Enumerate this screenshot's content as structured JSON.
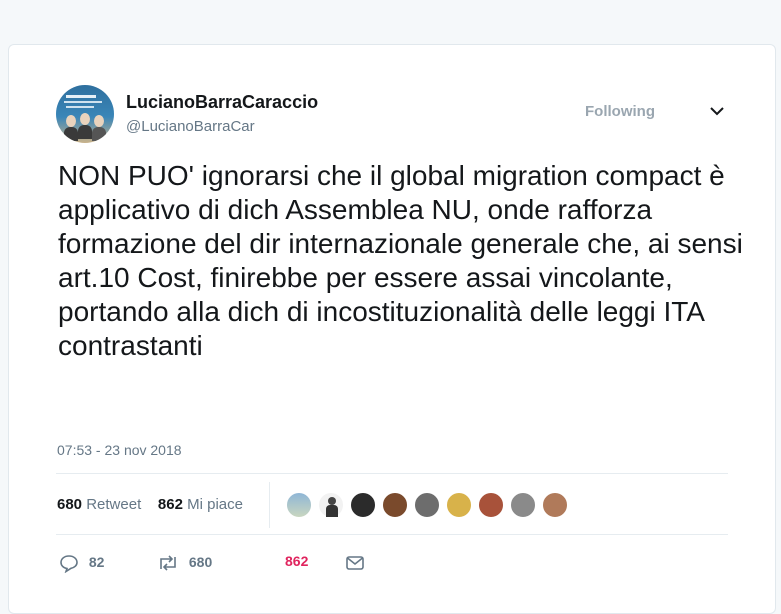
{
  "tweet": {
    "author_name": "LucianoBarraCaraccio",
    "author_handle": "@LucianoBarraCar",
    "follow_label": "Following",
    "text": "NON PUO' ignorarsi che il global migration compact è applicativo di dich Assemblea NU, onde rafforza formazione del dir internazionale generale che, ai sensi art.10 Cost, finirebbe per essere assai vincolante, portando alla dich di incostituzionalità delle leggi ITA contrastanti",
    "timestamp": "07:53 - 23 nov 2018"
  },
  "stats": {
    "retweet_count": "680",
    "retweet_label": "Retweet",
    "like_count": "862",
    "like_label": "Mi piace"
  },
  "actions": {
    "reply_count": "82",
    "retweet_count": "680",
    "like_count": "862"
  },
  "icons": [
    "chevron-down-icon",
    "reply-icon",
    "retweet-icon",
    "heart-icon",
    "message-icon"
  ],
  "colors": {
    "like": "#e0245e",
    "muted": "#657786",
    "text": "#14171a"
  }
}
